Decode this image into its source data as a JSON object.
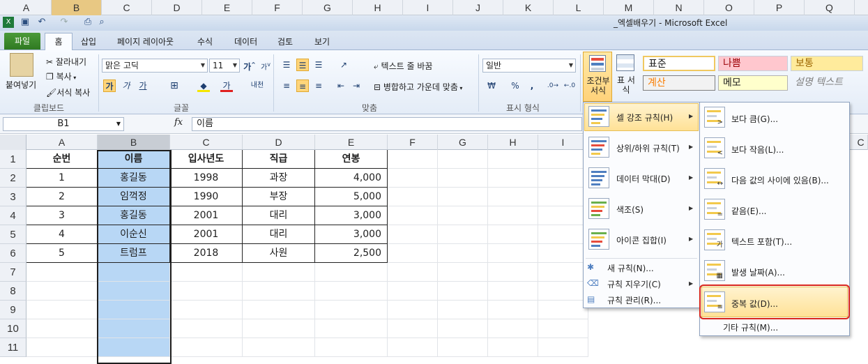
{
  "outer_columns": [
    "A",
    "B",
    "C",
    "D",
    "E",
    "F",
    "G",
    "H",
    "I",
    "J",
    "K",
    "L",
    "M",
    "N",
    "O",
    "P",
    "Q"
  ],
  "window": {
    "title": "_엑셀배우기  -  Microsoft Excel"
  },
  "tabs": [
    "파일",
    "홈",
    "삽입",
    "페이지 레이아웃",
    "수식",
    "데이터",
    "검토",
    "보기"
  ],
  "ribbon": {
    "clipboard": {
      "paste": "붙여넣기",
      "cut": "잘라내기",
      "copy": "복사",
      "format_painter": "서식 복사",
      "label": "클립보드"
    },
    "font": {
      "name": "맑은 고딕",
      "size": "11",
      "bold": "가",
      "italic": "가",
      "underline": "가",
      "label": "글꼴",
      "grow": "가",
      "shrink": "가",
      "font_color_glyph": "가",
      "phonetic": "내천"
    },
    "alignment": {
      "wrap": "텍스트 줄 바꿈",
      "merge": "병합하고 가운데 맞춤",
      "label": "맞춤"
    },
    "number": {
      "format": "일반",
      "percent": "%",
      "comma": ",",
      "label": "표시 형식"
    },
    "styles": {
      "conditional": "조건부 서식",
      "table": "표 서식",
      "normal": "표준",
      "bad": "나쁨",
      "neutral": "보통",
      "calc": "계산",
      "memo": "메모",
      "explain": "설명 텍스트"
    }
  },
  "formula_bar": {
    "name_box": "B1",
    "fx": "fx",
    "content": "이름"
  },
  "grid": {
    "columns": [
      "A",
      "B",
      "C",
      "D",
      "E",
      "F",
      "G",
      "H",
      "I"
    ],
    "right_partial_column": "C",
    "rows": [
      "1",
      "2",
      "3",
      "4",
      "5",
      "6",
      "7",
      "8",
      "9",
      "10",
      "11"
    ],
    "headers": [
      "순번",
      "이름",
      "입사년도",
      "직급",
      "연봉"
    ],
    "data": [
      [
        "1",
        "홍길동",
        "1998",
        "과장",
        "4,000"
      ],
      [
        "2",
        "임꺽정",
        "1990",
        "부장",
        "5,000"
      ],
      [
        "3",
        "홍길동",
        "2001",
        "대리",
        "3,000"
      ],
      [
        "4",
        "이순신",
        "2001",
        "대리",
        "3,000"
      ],
      [
        "5",
        "트럼프",
        "2018",
        "사원",
        "2,500"
      ]
    ]
  },
  "menu_main": {
    "items": [
      {
        "label": "셀 강조 규칙(H)",
        "highlighted": true
      },
      {
        "label": "상위/하위 규칙(T)"
      },
      {
        "label": "데이터 막대(D)"
      },
      {
        "label": "색조(S)"
      },
      {
        "label": "아이콘 집합(I)"
      }
    ],
    "small_items": [
      "새 규칙(N)...",
      "규칙 지우기(C)",
      "규칙 관리(R)..."
    ]
  },
  "menu_sub": {
    "items": [
      "보다 큼(G)...",
      "보다 작음(L)...",
      "다음 값의 사이에 있음(B)...",
      "같음(E)...",
      "텍스트 포함(T)...",
      "발생 날짜(A)...",
      "중복 값(D)..."
    ],
    "highlight_index": 6,
    "footer": "기타 규칙(M)..."
  },
  "colors": {
    "accent_file_tab": "#2f7a22",
    "selection": "#b8d7f5",
    "menu_highlight": "#ffe196",
    "callout_red": "#d9261c"
  }
}
